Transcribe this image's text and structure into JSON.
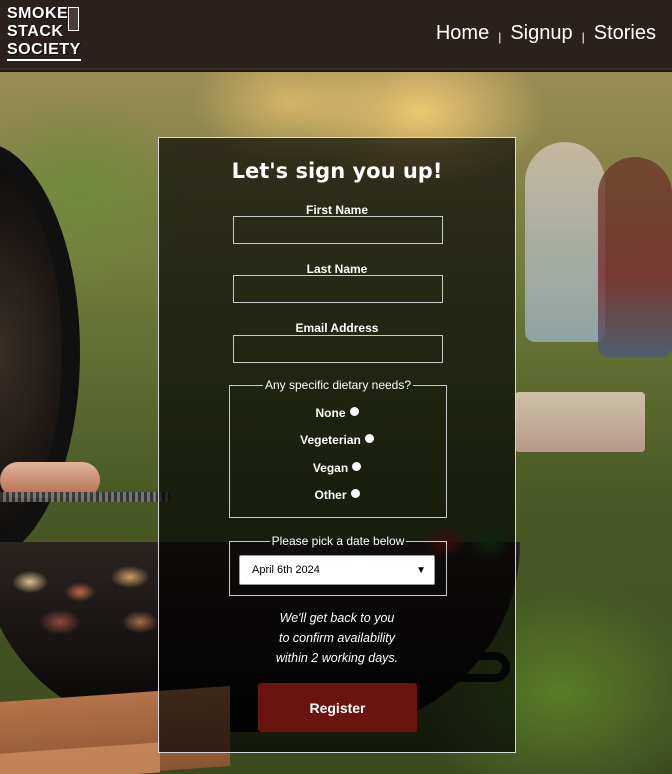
{
  "logo": {
    "lines": [
      "SMOKE",
      "STACK",
      "SOCIETY"
    ]
  },
  "nav": {
    "items": [
      "Home",
      "Signup",
      "Stories"
    ],
    "separator": "|"
  },
  "form": {
    "title": "Let's sign you up!",
    "first_name_label": "First Name",
    "first_name_value": "",
    "last_name_label": "Last Name",
    "last_name_value": "",
    "email_label": "Email Address",
    "email_value": "",
    "diet_legend": "Any specific dietary needs?",
    "diet_options": [
      "None",
      "Vegeterian",
      "Vegan",
      "Other"
    ],
    "date_legend": "Please pick a date below",
    "date_selected": "April 6th 2024",
    "note_lines": [
      "We'll get back to you",
      "to confirm availability",
      "within 2 working days."
    ],
    "register_label": "Register"
  },
  "colors": {
    "header_bg": "#2a211c",
    "button_bg": "#6b130e",
    "card_bg": "rgba(0,0,0,0.66)"
  }
}
